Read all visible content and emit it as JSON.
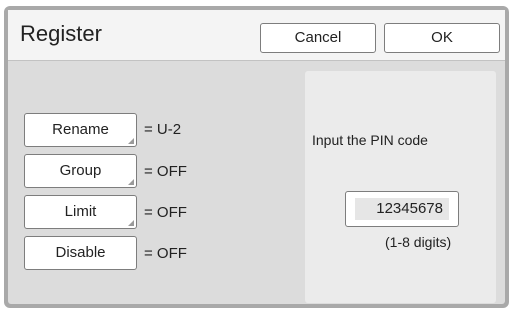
{
  "dialog": {
    "title": "Register",
    "cancel_label": "Cancel",
    "ok_label": "OK"
  },
  "settings": [
    {
      "label": "Rename",
      "value": "= U-2"
    },
    {
      "label": "Group",
      "value": "= OFF"
    },
    {
      "label": "Limit",
      "value": "= OFF"
    },
    {
      "label": "Disable",
      "value": "= OFF"
    }
  ],
  "pin": {
    "prompt": "Input the PIN code",
    "value": "12345678",
    "hint": "(1-8 digits)"
  }
}
